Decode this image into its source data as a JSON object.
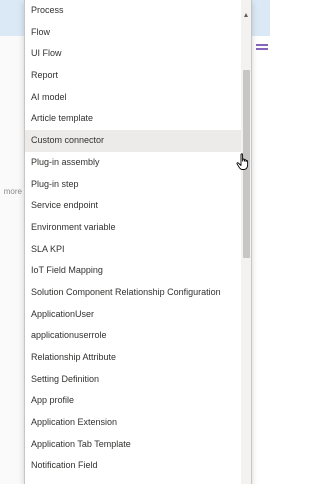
{
  "background": {
    "more_text": "more",
    "accent_color": "#8764b8"
  },
  "dropdown": {
    "options": [
      "Process",
      "Flow",
      "UI Flow",
      "Report",
      "AI model",
      "Article template",
      "Custom connector",
      "Plug-in assembly",
      "Plug-in step",
      "Service endpoint",
      "Environment variable",
      "SLA KPI",
      "IoT Field Mapping",
      "Solution Component Relationship Configuration",
      "ApplicationUser",
      "applicationuserrole",
      "Relationship Attribute",
      "Setting Definition",
      "App profile",
      "Application Extension",
      "Application Tab Template",
      "Notification Field"
    ],
    "highlighted_option": "Custom connector",
    "highlight_color": "#edebe9"
  },
  "icons": {
    "scroll_up": "chevron-up-icon",
    "cursor": "hand-pointer-icon",
    "menu": "hamburger-icon"
  }
}
